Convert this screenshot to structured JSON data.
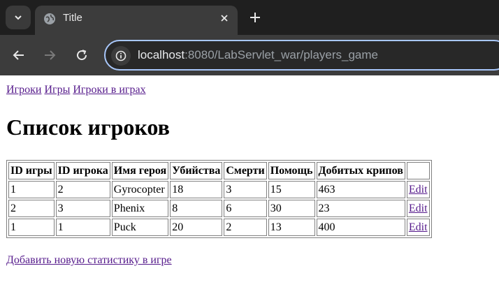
{
  "browser": {
    "tab_title": "Title",
    "url_host": "localhost",
    "url_rest": ":8080/LabServlet_war/players_game"
  },
  "nav": {
    "links": [
      "Игроки",
      "Игры",
      "Игроки в играх"
    ]
  },
  "page_title": "Список игроков",
  "table": {
    "headers": [
      "ID игры",
      "ID игрока",
      "Имя героя",
      "Убийства",
      "Смерти",
      "Помощь",
      "Добитых крипов",
      ""
    ],
    "rows": [
      {
        "game_id": "1",
        "player_id": "2",
        "hero": "Gyrocopter",
        "kills": "18",
        "deaths": "3",
        "assists": "15",
        "creeps": "463",
        "edit": "Edit"
      },
      {
        "game_id": "2",
        "player_id": "3",
        "hero": "Phenix",
        "kills": "8",
        "deaths": "6",
        "assists": "30",
        "creeps": "23",
        "edit": "Edit"
      },
      {
        "game_id": "1",
        "player_id": "1",
        "hero": "Puck",
        "kills": "20",
        "deaths": "2",
        "assists": "13",
        "creeps": "400",
        "edit": "Edit"
      }
    ]
  },
  "add_link": "Добавить новую статистику в игре",
  "colors": {
    "link_visited": "#551a8b",
    "chrome_dark": "#1f1f1f",
    "omnibox_focus": "#a8c7fa"
  },
  "icons": {
    "tab_search": "chevron-down-icon",
    "favicon": "globe-icon",
    "tab_close": "close-icon",
    "new_tab": "plus-icon",
    "back": "back-arrow-icon",
    "forward": "forward-arrow-icon",
    "reload": "reload-icon",
    "site_info": "site-info-icon"
  }
}
